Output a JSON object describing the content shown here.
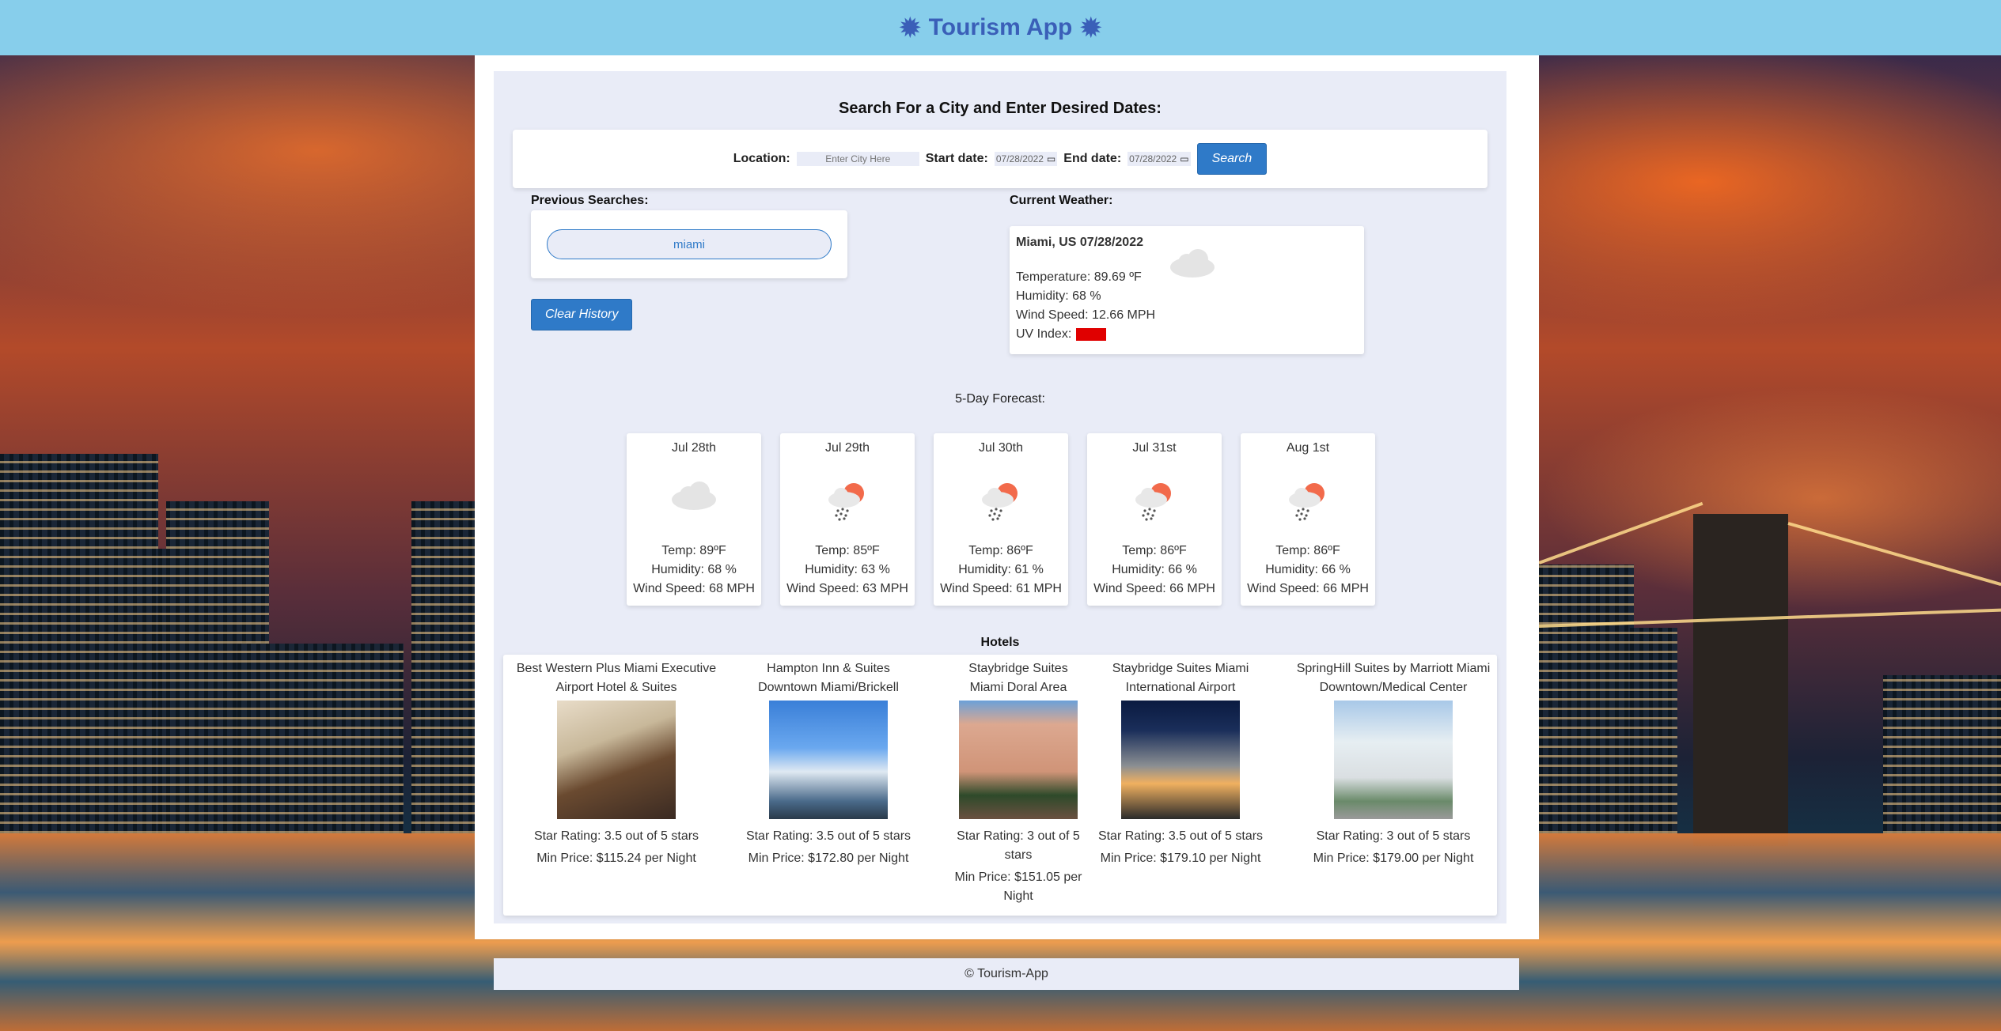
{
  "app": {
    "title": "Tourism App",
    "icon": "gear-icon",
    "accent": "#3a5fb8",
    "header_bg": "#87ceeb"
  },
  "search": {
    "heading": "Search For a City and Enter Desired Dates:",
    "location_label": "Location:",
    "location_placeholder": "Enter City Here",
    "start_label": "Start date:",
    "start_value": "07/28/2022",
    "end_label": "End date:",
    "end_value": "07/28/2022",
    "button_label": "Search"
  },
  "previous": {
    "label": "Previous Searches:",
    "items": [
      "miami"
    ],
    "clear_label": "Clear History"
  },
  "current_weather": {
    "label": "Current Weather:",
    "title": "Miami, US 07/28/2022",
    "temperature": "Temperature: 89.69 ºF",
    "humidity": "Humidity: 68 %",
    "wind": "Wind Speed: 12.66 MPH",
    "uv_label": "UV Index:",
    "uv_color": "#e00000",
    "icon": "cloud-icon"
  },
  "forecast": {
    "label": "5-Day Forecast:",
    "days": [
      {
        "date": "Jul 28th",
        "icon": "cloud-icon",
        "temp": "Temp: 89ºF",
        "humidity": "Humidity: 68 %",
        "wind": "Wind Speed: 68 MPH"
      },
      {
        "date": "Jul 29th",
        "icon": "rain-sun-icon",
        "temp": "Temp: 85ºF",
        "humidity": "Humidity: 63 %",
        "wind": "Wind Speed: 63 MPH"
      },
      {
        "date": "Jul 30th",
        "icon": "rain-sun-icon",
        "temp": "Temp: 86ºF",
        "humidity": "Humidity: 61 %",
        "wind": "Wind Speed: 61 MPH"
      },
      {
        "date": "Jul 31st",
        "icon": "rain-sun-icon",
        "temp": "Temp: 86ºF",
        "humidity": "Humidity: 66 %",
        "wind": "Wind Speed: 66 MPH"
      },
      {
        "date": "Aug 1st",
        "icon": "rain-sun-icon",
        "temp": "Temp: 86ºF",
        "humidity": "Humidity: 66 %",
        "wind": "Wind Speed: 66 MPH"
      }
    ]
  },
  "hotels": {
    "label": "Hotels",
    "items": [
      {
        "name1": "Best Western Plus Miami Executive",
        "name2": "Airport Hotel & Suites",
        "rating1": "Star Rating: 3.5 out of 5 stars",
        "rating2": "",
        "price1": "Min Price: $115.24 per Night",
        "price2": ""
      },
      {
        "name1": "Hampton Inn & Suites",
        "name2": "Downtown Miami/Brickell",
        "rating1": "Star Rating: 3.5 out of 5 stars",
        "rating2": "",
        "price1": "Min Price: $172.80 per Night",
        "price2": ""
      },
      {
        "name1": "Staybridge Suites",
        "name2": "Miami Doral Area",
        "rating1": "Star Rating: 3 out of 5",
        "rating2": "stars",
        "price1": "Min Price: $151.05 per",
        "price2": "Night"
      },
      {
        "name1": "Staybridge Suites Miami",
        "name2": "International Airport",
        "rating1": "Star Rating: 3.5 out of 5 stars",
        "rating2": "",
        "price1": "Min Price: $179.10 per Night",
        "price2": ""
      },
      {
        "name1": "SpringHill Suites by Marriott Miami",
        "name2": "Downtown/Medical Center",
        "rating1": "Star Rating: 3 out of 5 stars",
        "rating2": "",
        "price1": "Min Price: $179.00 per Night",
        "price2": ""
      }
    ]
  },
  "footer": {
    "text": "© Tourism-App"
  }
}
